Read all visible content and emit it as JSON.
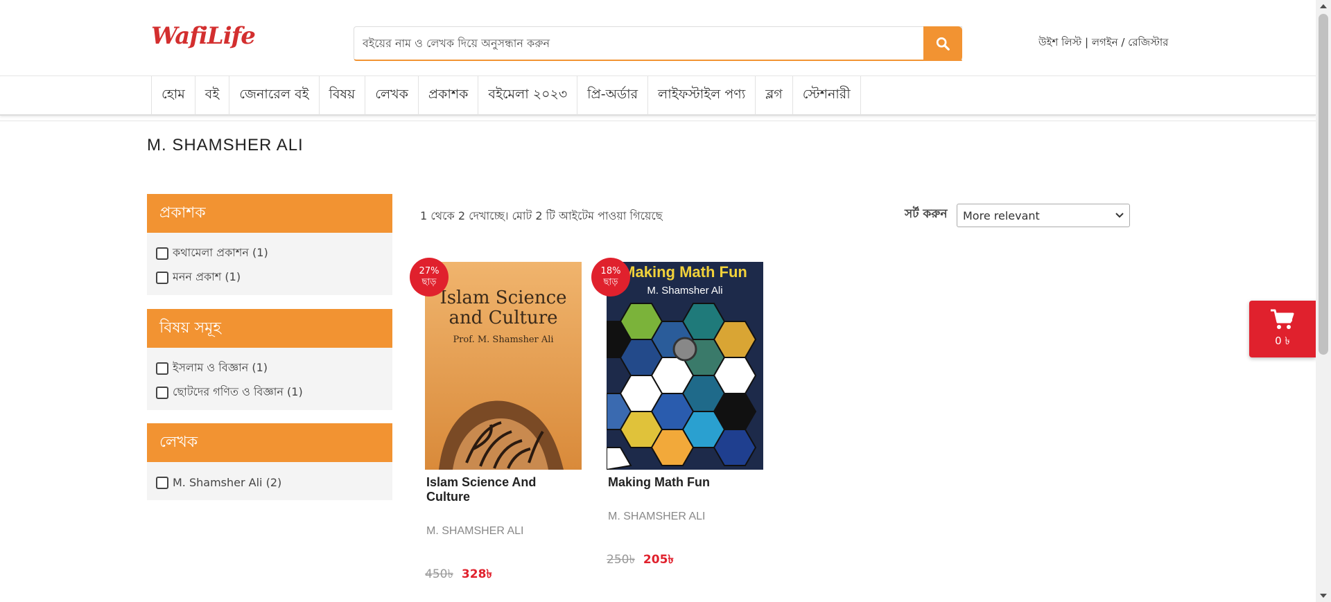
{
  "header": {
    "logo_text": "WafiLife",
    "search_placeholder": "বইয়ের নাম ও লেখক দিয়ে অনুসন্ধান করুন",
    "wishlist_label": "উইশ লিস্ট",
    "login_label": "লগইন",
    "register_label": "রেজিস্টার",
    "separator_pipe": " | ",
    "separator_slash": " / "
  },
  "nav": {
    "items": [
      "হোম",
      "বই",
      "জেনারেল বই",
      "বিষয়",
      "লেখক",
      "প্রকাশক",
      "বইমেলা ২০২৩",
      "প্রি-অর্ডার",
      "লাইফস্টাইল পণ্য",
      "ব্লগ",
      "স্টেশনারী"
    ]
  },
  "page": {
    "title": "M. SHAMSHER ALI"
  },
  "filters": [
    {
      "title": "প্রকাশক",
      "options": [
        "কথামেলা প্রকাশন (1)",
        "মনন প্রকাশ (1)"
      ]
    },
    {
      "title": "বিষয় সমূহ",
      "options": [
        "ইসলাম ও বিজ্ঞান (1)",
        "ছোটদের গণিত ও বিজ্ঞান (1)"
      ]
    },
    {
      "title": "লেখক",
      "options": [
        "M. Shamsher Ali (2)"
      ]
    }
  ],
  "results": {
    "info": "1 থেকে 2 দেখাচ্ছে। মোট 2 টি আইটেম পাওয়া গিয়েছে",
    "sort_label": "সর্ট করুন",
    "sort_value": "More relevant"
  },
  "products": [
    {
      "title": "Islam Science And Culture",
      "author": "M. SHAMSHER ALI",
      "old_price": "450৳",
      "new_price": "328৳",
      "discount_pct": "27%",
      "discount_word": "ছাড়",
      "cover": {
        "line1": "Islam Science",
        "line2": "and Culture",
        "byline": "Prof. M. Shamsher Ali"
      }
    },
    {
      "title": "Making Math Fun",
      "author": "M. SHAMSHER ALI",
      "old_price": "250৳",
      "new_price": "205৳",
      "discount_pct": "18%",
      "discount_word": "ছাড়",
      "cover": {
        "line1": "Making Math Fun",
        "byline": "M. Shamsher Ali"
      }
    }
  ],
  "cart": {
    "amount": "0 ৳"
  },
  "colors": {
    "accent": "#f29332",
    "red": "#e0212d",
    "logo_red": "#d32f2f"
  }
}
